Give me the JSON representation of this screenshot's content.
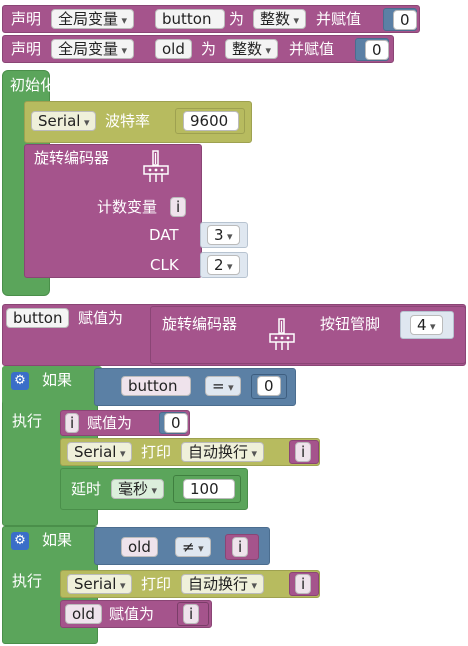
{
  "declare": [
    {
      "kw": "声明",
      "scope": "全局变量",
      "name": "button",
      "as": "为",
      "type": "整数",
      "assign": "并赋值",
      "value": "0"
    },
    {
      "kw": "声明",
      "scope": "全局变量",
      "name": "old",
      "as": "为",
      "type": "整数",
      "assign": "并赋值",
      "value": "0"
    }
  ],
  "setup": {
    "title": "初始化",
    "serial": {
      "port": "Serial",
      "label": "波特率",
      "baud": "9600"
    },
    "encoder": {
      "label": "旋转编码器",
      "count_label": "计数变量",
      "count_var": "i",
      "dat_label": "DAT",
      "dat_value": "3",
      "clk_label": "CLK",
      "clk_value": "2"
    }
  },
  "assign_button": {
    "var": "button",
    "label": "赋值为",
    "encoder": "旋转编码器",
    "pin_label": "按钮管脚",
    "pin": "4"
  },
  "if1": {
    "if_label": "如果",
    "do_label": "执行",
    "cond": {
      "left": "button",
      "op": "=",
      "right": "0"
    },
    "set_i": {
      "var": "i",
      "label": "赋值为",
      "value": "0"
    },
    "print": {
      "port": "Serial",
      "label": "打印",
      "mode": "自动换行",
      "var": "i"
    },
    "delay": {
      "label": "延时",
      "unit": "毫秒",
      "value": "100"
    }
  },
  "if2": {
    "if_label": "如果",
    "do_label": "执行",
    "cond": {
      "left": "old",
      "op": "≠",
      "right": "i"
    },
    "print": {
      "port": "Serial",
      "label": "打印",
      "mode": "自动换行",
      "var": "i"
    },
    "set_old": {
      "var": "old",
      "label": "赋值为",
      "value": "i"
    }
  }
}
